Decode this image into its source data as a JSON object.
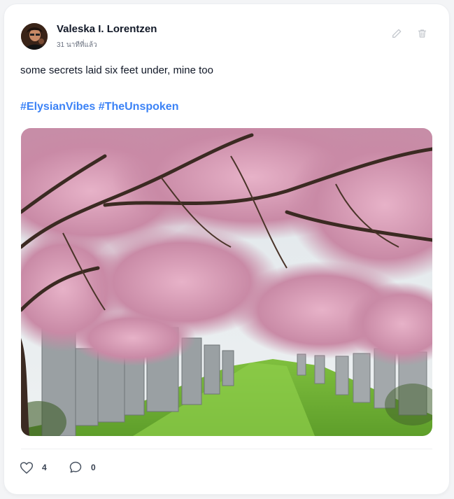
{
  "post": {
    "author": "Valeska I. Lorentzen",
    "time": "31 นาทีที่แล้ว",
    "text": "some secrets laid six feet under, mine too",
    "hashtags": [
      "#ElysianVibes",
      "#TheUnspoken"
    ],
    "likes": "4",
    "comments": "0"
  },
  "icons": {
    "edit": "pencil-icon",
    "delete": "trash-icon",
    "like": "heart-icon",
    "comment": "speech-bubble-icon"
  },
  "colors": {
    "hashtag": "#3b82f6",
    "icon_muted": "#c4c8ce"
  }
}
